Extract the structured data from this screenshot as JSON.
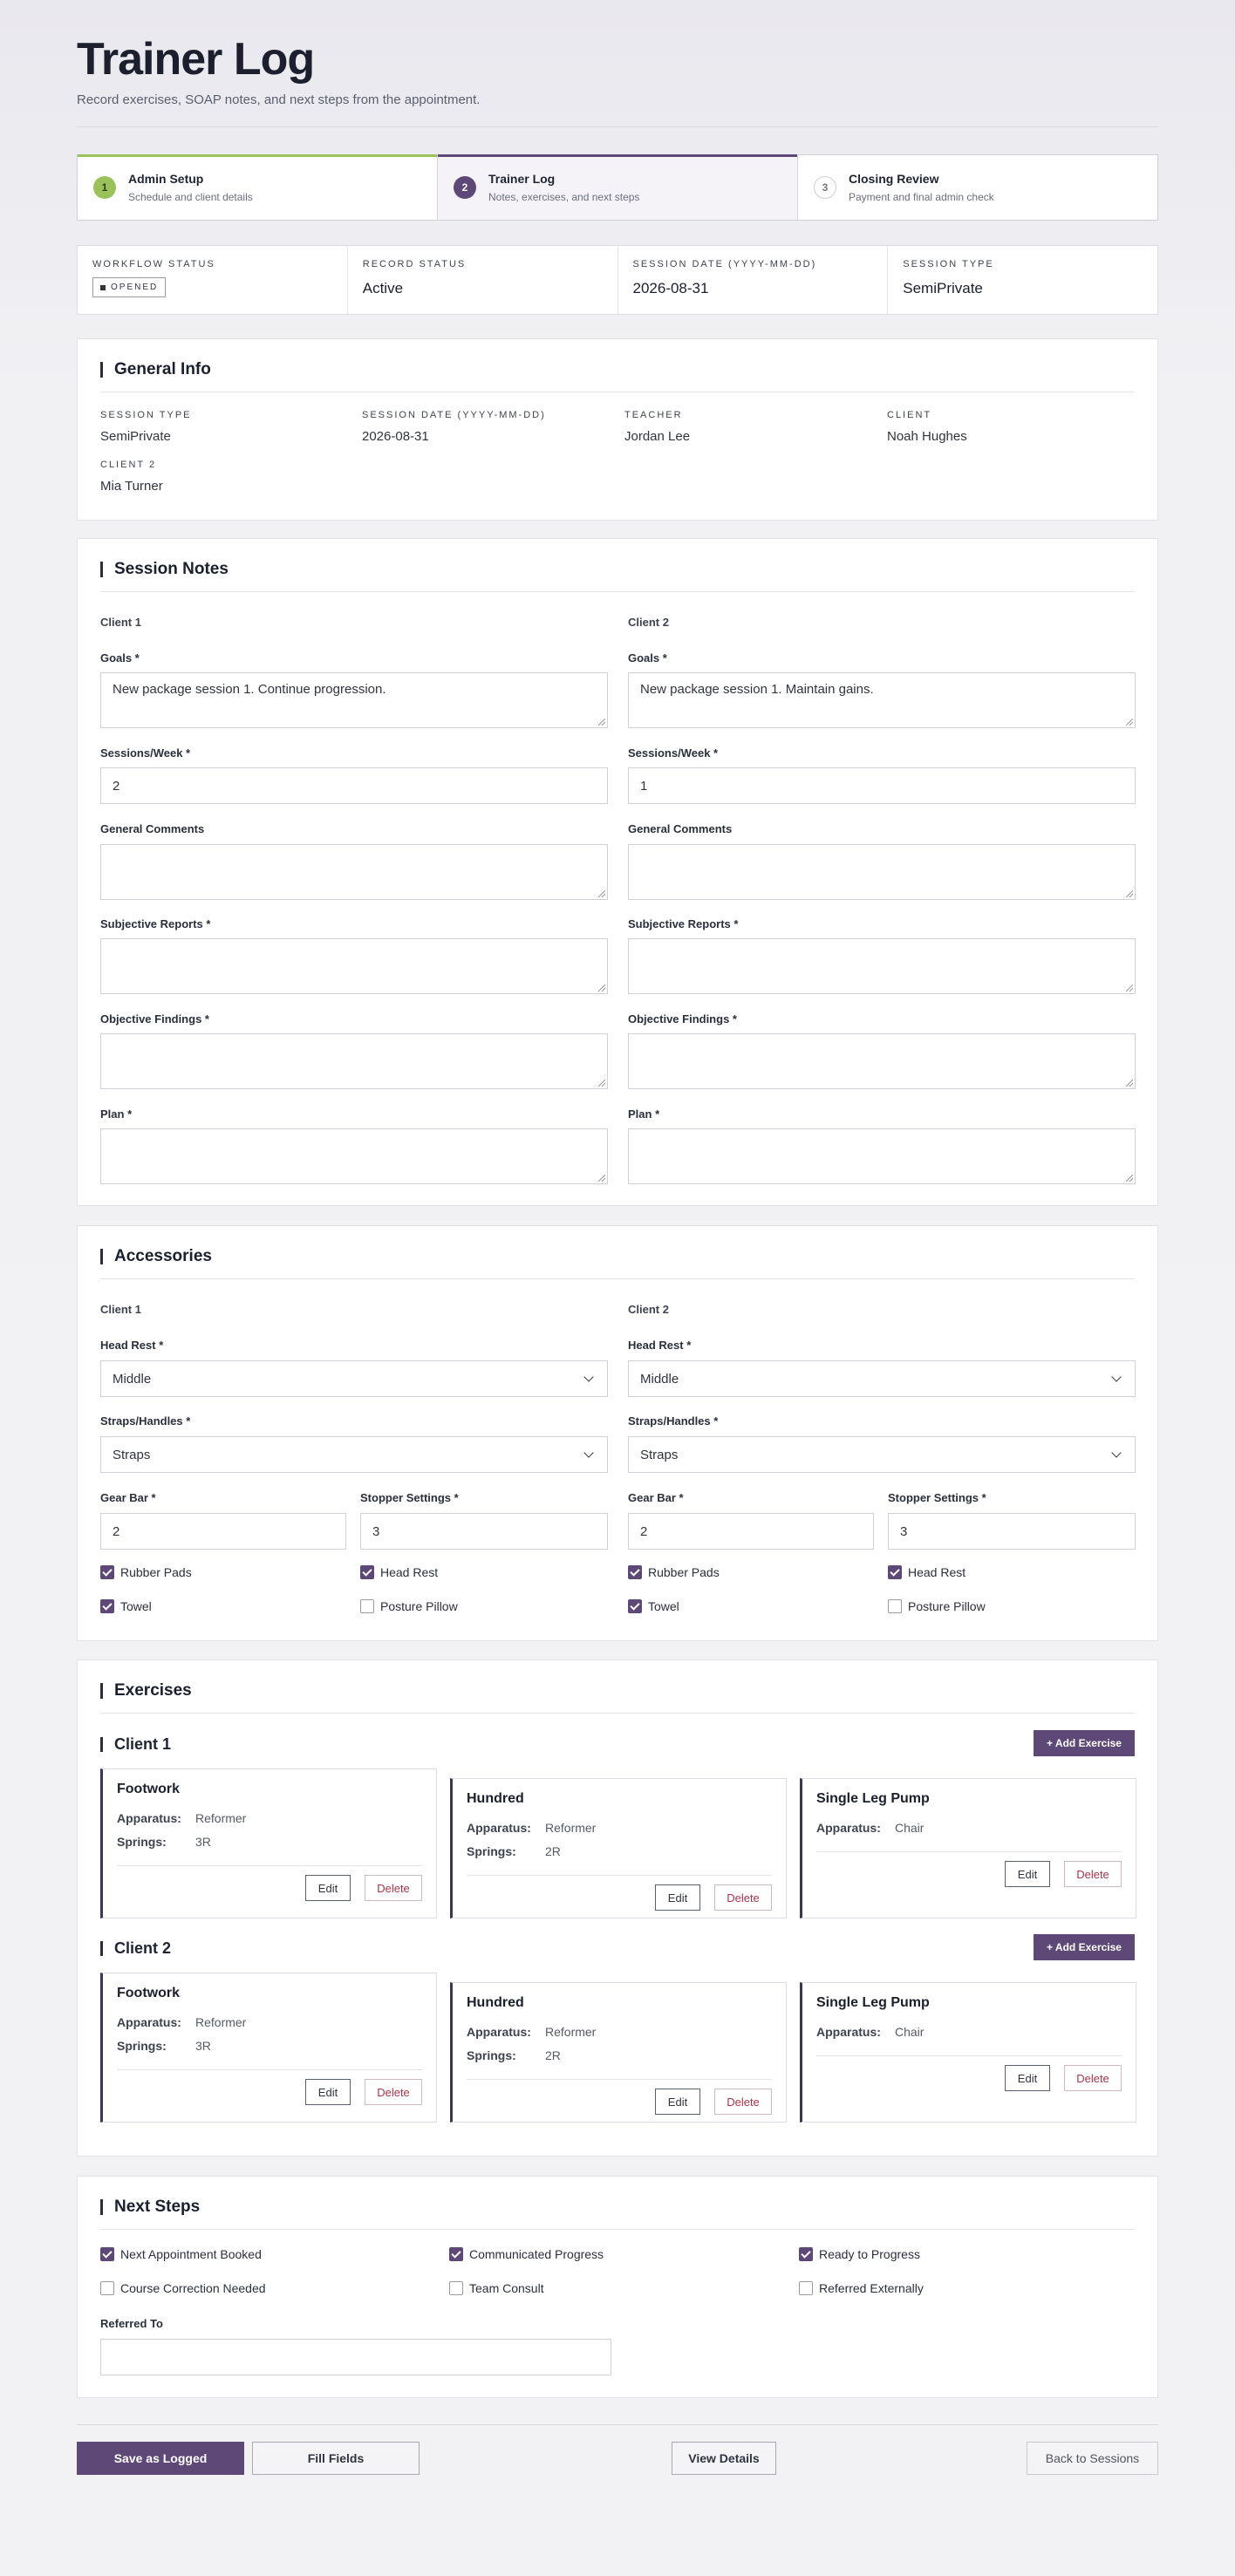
{
  "header": {
    "title": "Trainer Log",
    "subtitle": "Record exercises, SOAP notes, and next steps from the appointment."
  },
  "steps": [
    {
      "num": "1",
      "title": "Admin Setup",
      "desc": "Schedule and client details",
      "state": "done"
    },
    {
      "num": "2",
      "title": "Trainer Log",
      "desc": "Notes, exercises, and next steps",
      "state": "active"
    },
    {
      "num": "3",
      "title": "Closing Review",
      "desc": "Payment and final admin check",
      "state": "todo"
    }
  ],
  "status": {
    "workflow_label": "WORKFLOW STATUS",
    "workflow_value": "OPENED",
    "record_label": "RECORD STATUS",
    "record_value": "Active",
    "date_label": "SESSION DATE (YYYY-MM-DD)",
    "date_value": "2026-08-31",
    "type_label": "SESSION TYPE",
    "type_value": "SemiPrivate"
  },
  "general": {
    "title": "General Info",
    "session_type_label": "SESSION TYPE",
    "session_type": "SemiPrivate",
    "session_date_label": "SESSION DATE (YYYY-MM-DD)",
    "session_date": "2026-08-31",
    "teacher_label": "TEACHER",
    "teacher": "Jordan Lee",
    "client_label": "CLIENT",
    "client": "Noah Hughes",
    "client2_label": "CLIENT 2",
    "client2": "Mia Turner"
  },
  "notes": {
    "title": "Session Notes",
    "labels": {
      "goals": "Goals",
      "sessions": "Sessions/Week",
      "comments": "General Comments",
      "subjective": "Subjective Reports",
      "objective": "Objective Findings",
      "plan": "Plan",
      "req": "*"
    },
    "c1": {
      "heading": "Client 1",
      "goals": "New package session 1. Continue progression.",
      "sessions": "2",
      "comments": "",
      "subjective": "",
      "objective": "",
      "plan": ""
    },
    "c2": {
      "heading": "Client 2",
      "goals": "New package session 1. Maintain gains.",
      "sessions": "1",
      "comments": "",
      "subjective": "",
      "objective": "",
      "plan": ""
    }
  },
  "accessories": {
    "title": "Accessories",
    "labels": {
      "head_rest": "Head Rest",
      "straps": "Straps/Handles",
      "gear_bar": "Gear Bar",
      "stopper": "Stopper Settings",
      "req": "*",
      "rubber": "Rubber Pads",
      "headrest_cb": "Head Rest",
      "towel": "Towel",
      "pillow": "Posture Pillow"
    },
    "c1": {
      "heading": "Client 1",
      "head_rest": "Middle",
      "straps": "Straps",
      "gear_bar": "2",
      "stopper": "3",
      "rubber": true,
      "headrest_cb": true,
      "towel": true,
      "pillow": false
    },
    "c2": {
      "heading": "Client 2",
      "head_rest": "Middle",
      "straps": "Straps",
      "gear_bar": "2",
      "stopper": "3",
      "rubber": true,
      "headrest_cb": true,
      "towel": true,
      "pillow": false
    }
  },
  "exercises": {
    "title": "Exercises",
    "add_label": "+ Add Exercise",
    "apparatus_label": "Apparatus:",
    "springs_label": "Springs:",
    "edit_label": "Edit",
    "delete_label": "Delete",
    "c1": {
      "heading": "Client 1",
      "items": [
        {
          "name": "Footwork",
          "apparatus": "Reformer",
          "springs": "3R"
        },
        {
          "name": "Hundred",
          "apparatus": "Reformer",
          "springs": "2R"
        },
        {
          "name": "Single Leg Pump",
          "apparatus": "Chair",
          "springs": ""
        }
      ]
    },
    "c2": {
      "heading": "Client 2",
      "items": [
        {
          "name": "Footwork",
          "apparatus": "Reformer",
          "springs": "3R"
        },
        {
          "name": "Hundred",
          "apparatus": "Reformer",
          "springs": "2R"
        },
        {
          "name": "Single Leg Pump",
          "apparatus": "Chair",
          "springs": ""
        }
      ]
    }
  },
  "next": {
    "title": "Next Steps",
    "items": [
      {
        "label": "Next Appointment Booked",
        "checked": true
      },
      {
        "label": "Communicated Progress",
        "checked": true
      },
      {
        "label": "Ready to Progress",
        "checked": true
      },
      {
        "label": "Course Correction Needed",
        "checked": false
      },
      {
        "label": "Team Consult",
        "checked": false
      },
      {
        "label": "Referred Externally",
        "checked": false
      }
    ],
    "referred_label": "Referred To",
    "referred_value": ""
  },
  "footer": {
    "save": "Save as Logged",
    "fill": "Fill Fields",
    "view": "View Details",
    "back": "Back to Sessions"
  },
  "colors": {
    "accent": "#5e4878",
    "done": "#9bc25a",
    "danger": "#a8354b"
  }
}
